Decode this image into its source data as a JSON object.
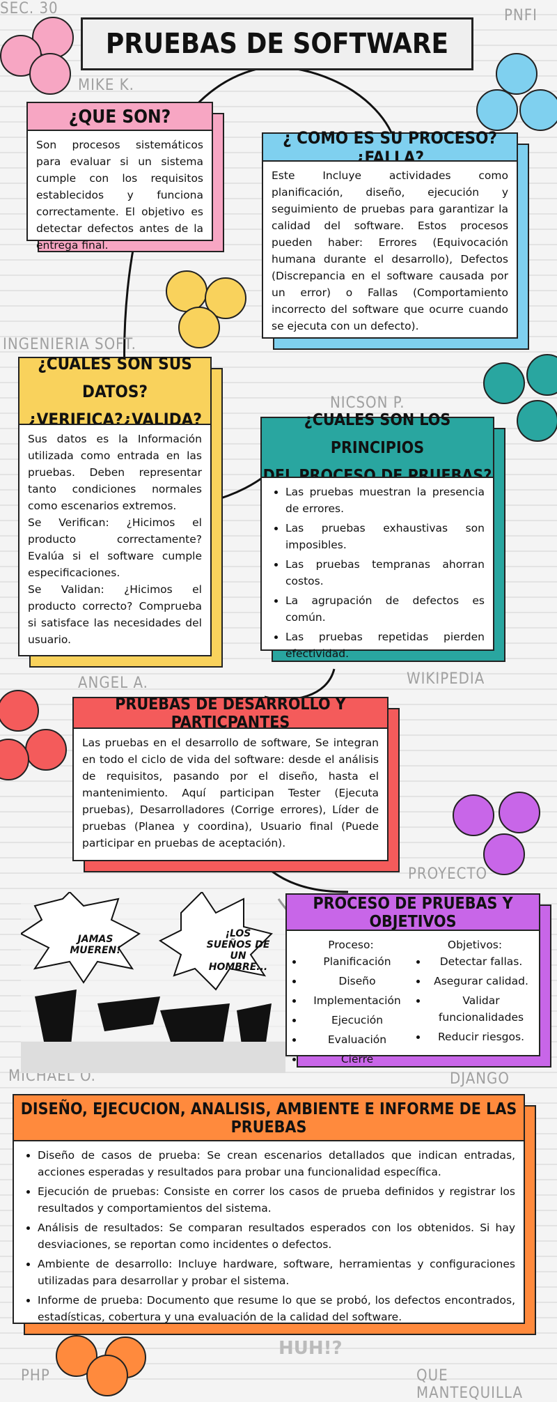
{
  "title": "PRUEBAS DE SOFTWARE",
  "tags": {
    "sec": "SEC. 30",
    "pnfi": "PNFI",
    "mike": "MIKE K.",
    "ing": "INGENIERIA SOFT.",
    "nicson": "NICSON P.",
    "angel": "ANGEL A.",
    "wiki": "WIKIPEDIA",
    "proyecto": "PROYECTO",
    "michael": "MICHAEL O.",
    "django": "DJANGO",
    "php": "PHP",
    "quemantequilla": "QUE MANTEQUILLA"
  },
  "colors": {
    "pink": "#f7a6c3",
    "blue": "#7fd0ef",
    "yellow": "#f9d25c",
    "teal": "#29a6a0",
    "red": "#f45b5b",
    "purple": "#c866e8",
    "orange": "#ff8a3d"
  },
  "que_son": {
    "heading": "¿QUE SON?",
    "text": "Son procesos sistemáticos para evaluar si un sistema cumple con los requisitos establecidos y funciona correctamente. El objetivo es detectar defectos antes de la entrega final."
  },
  "proceso_falla": {
    "heading": "¿ COMO ES SU PROCESO?¿FALLA?",
    "text": "Este Incluye actividades como planificación, diseño, ejecución y seguimiento de pruebas para garantizar la calidad del software. Estos procesos pueden haber: Errores (Equivocación humana durante el desarrollo), Defectos (Discrepancia en el software causada por un error) o Fallas (Comportamiento incorrecto del software que ocurre cuando se ejecuta con un defecto)."
  },
  "datos": {
    "heading1": "¿CUALES SON SUS DATOS?",
    "heading2": "¿VERIFICA?¿VALIDA?",
    "p1": "Sus datos es la Información utilizada como entrada en las pruebas. Deben representar tanto condiciones normales como escenarios extremos.",
    "p2": "Se Verifican: ¿Hicimos el producto correctamente? Evalúa si el software cumple especificaciones.",
    "p3": "Se Validan: ¿Hicimos el producto correcto? Comprueba si satisface las necesidades del usuario."
  },
  "principios": {
    "heading1": "¿CUALES SON LOS PRINCIPIOS",
    "heading2": "DEL PROCESO DE PRUEBAS?",
    "items": [
      "Las pruebas muestran la presencia de errores.",
      "Las pruebas exhaustivas son imposibles.",
      "Las pruebas tempranas ahorran costos.",
      "La agrupación de defectos es común.",
      "Las pruebas repetidas pierden efectividad."
    ]
  },
  "desarrollo": {
    "heading": "PRUEBAS DE DESARROLLO Y PARTICPANTES",
    "text": " Las pruebas en el desarrollo de software, Se integran en todo el ciclo de vida del software: desde el análisis de requisitos, pasando por el diseño, hasta el mantenimiento. Aquí participan Tester (Ejecuta pruebas), Desarrolladores (Corrige errores), Líder de pruebas (Planea y coordina), Usuario final (Puede participar en pruebas de aceptación)."
  },
  "objetivos": {
    "heading": "PROCESO DE PRUEBAS Y OBJETIVOS",
    "proceso_label": "Proceso:",
    "proceso": [
      "Planificación",
      "Diseño",
      "Implementación",
      "Ejecución",
      "Evaluación",
      "Cierre"
    ],
    "objetivos_label": "Objetivos:",
    "objetivos": [
      "Detectar fallas.",
      "Asegurar calidad.",
      "Validar funcionalidades",
      "Reducir riesgos."
    ]
  },
  "manga": {
    "bubble1": "JAMAS MUEREN!",
    "bubble2": "¡LOS SUEÑOS DE UN HOMBRE...",
    "bubble3": "HUH!?"
  },
  "diseno": {
    "heading": "DISEÑO, EJECUCION, ANALISIS, AMBIENTE E INFORME DE LAS PRUEBAS",
    "items": [
      "Diseño de casos de prueba: Se crean escenarios detallados que indican entradas, acciones esperadas y resultados para probar una funcionalidad específica.",
      "Ejecución de pruebas: Consiste en correr los casos de prueba definidos y registrar los resultados y comportamientos del sistema.",
      "Análisis de resultados: Se comparan resultados esperados con los obtenidos. Si hay desviaciones, se reportan como incidentes o defectos.",
      "Ambiente de desarrollo: Incluye hardware, software, herramientas y configuraciones utilizadas para desarrollar y probar el sistema.",
      "Informe de prueba: Documento que resume lo que se probó, los defectos encontrados, estadísticas, cobertura y una evaluación de la calidad del software."
    ]
  }
}
